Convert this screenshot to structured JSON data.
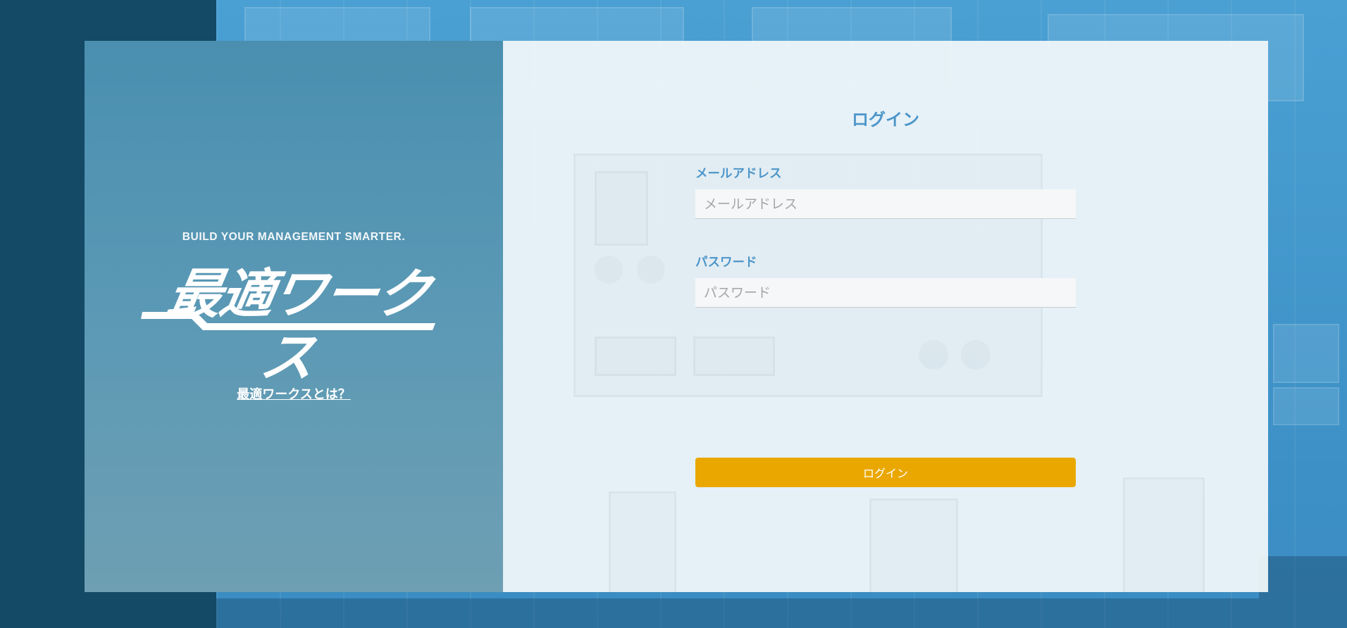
{
  "brand": {
    "tagline": "BUILD YOUR MANAGEMENT SMARTER.",
    "logo_text": "最適ワークス",
    "about_link": "最適ワークスとは？"
  },
  "login": {
    "title": "ログイン",
    "email": {
      "label": "メールアドレス",
      "placeholder": "メールアドレス",
      "value": ""
    },
    "password": {
      "label": "パスワード",
      "placeholder": "パスワード",
      "value": ""
    },
    "submit_label": "ログイン"
  },
  "colors": {
    "accent_blue": "#4d96c9",
    "button_orange": "#eaa700",
    "dark_strip": "#144a66",
    "brand_panel": "#5b99b5"
  }
}
